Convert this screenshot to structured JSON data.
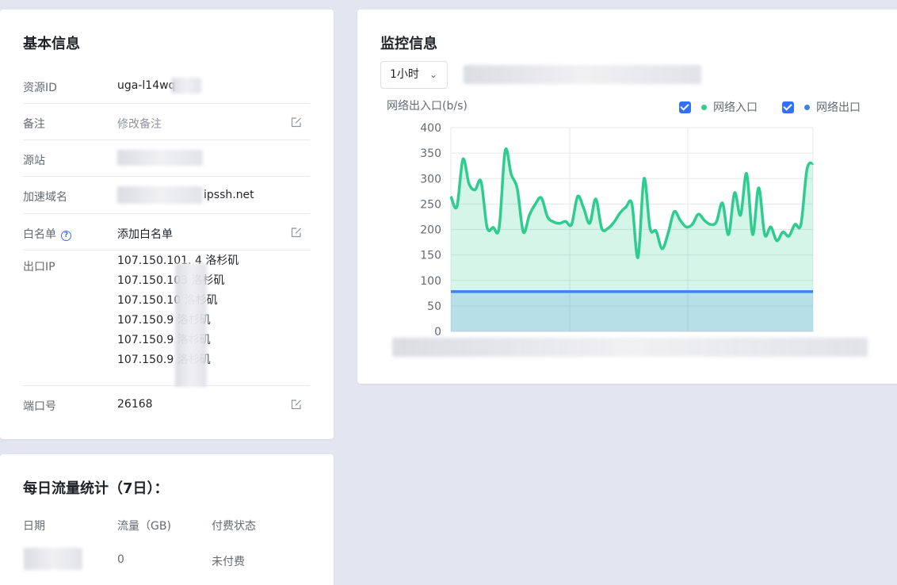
{
  "basic": {
    "title": "基本信息",
    "rows": {
      "resource_id": {
        "label": "资源ID",
        "value": "uga-l14wq"
      },
      "note": {
        "label": "备注",
        "value": "修改备注"
      },
      "origin": {
        "label": "源站",
        "value": ""
      },
      "domain": {
        "label": "加速域名",
        "value": "ipssh.net"
      },
      "whitelist": {
        "label": "白名单",
        "value": "添加白名单",
        "help": "?"
      },
      "egress": {
        "label": "出口IP",
        "lines": [
          "107.150.101.  4 洛杉矶",
          "107.150.103  洛杉矶",
          "107.150.10  洛杉矶",
          "107.150.9  洛杉矶",
          "107.150.9  洛杉矶",
          "107.150.9  洛杉矶"
        ]
      },
      "port": {
        "label": "端口号",
        "value": "26168"
      }
    }
  },
  "monitor": {
    "title": "监控信息",
    "range_select": "1小时",
    "legend": [
      {
        "label": "网络入口",
        "color": "#2ecc8f",
        "checked": true
      },
      {
        "label": "网络出口",
        "color": "#3a86e8",
        "checked": true
      }
    ]
  },
  "daily": {
    "title": "每日流量统计（7日）：",
    "headers": [
      "日期",
      "流量（GB)",
      "付费状态"
    ],
    "rows": [
      {
        "date": "",
        "traffic": "0",
        "status": "未付费"
      }
    ]
  },
  "chart_data": {
    "type": "area",
    "title": "",
    "ylabel": "网络出入口(b/s)",
    "ylim": [
      0,
      400
    ],
    "yticks": [
      0,
      50,
      100,
      150,
      200,
      250,
      300,
      350,
      400
    ],
    "grid": true,
    "legend_position": "top-right",
    "series": [
      {
        "name": "网络入口",
        "color": "#2ecc8f",
        "values": [
          265,
          245,
          338,
          290,
          278,
          294,
          204,
          204,
          204,
          355,
          308,
          280,
          195,
          228,
          250,
          262,
          225,
          215,
          212,
          216,
          210,
          265,
          242,
          212,
          260,
          202,
          202,
          214,
          232,
          244,
          250,
          145,
          300,
          202,
          197,
          162,
          193,
          235,
          218,
          205,
          210,
          230,
          218,
          210,
          215,
          252,
          190,
          272,
          228,
          310,
          190,
          282,
          190,
          205,
          178,
          195,
          187,
          210,
          210,
          318,
          330
        ]
      },
      {
        "name": "网络出口",
        "color": "#3a86e8",
        "values": [
          78,
          78,
          78,
          78,
          78,
          78,
          78,
          78,
          78,
          78,
          78,
          78,
          78,
          78,
          78,
          78,
          78,
          78,
          78,
          78,
          78,
          78,
          78,
          78,
          78,
          78,
          78,
          78,
          78,
          78,
          78,
          78,
          78,
          78,
          78,
          78,
          78,
          78,
          78,
          78,
          78,
          78,
          78,
          78,
          78,
          78,
          78,
          78,
          78,
          78,
          78,
          78,
          78,
          78,
          78,
          78,
          78,
          78,
          78,
          78,
          78
        ]
      }
    ]
  }
}
